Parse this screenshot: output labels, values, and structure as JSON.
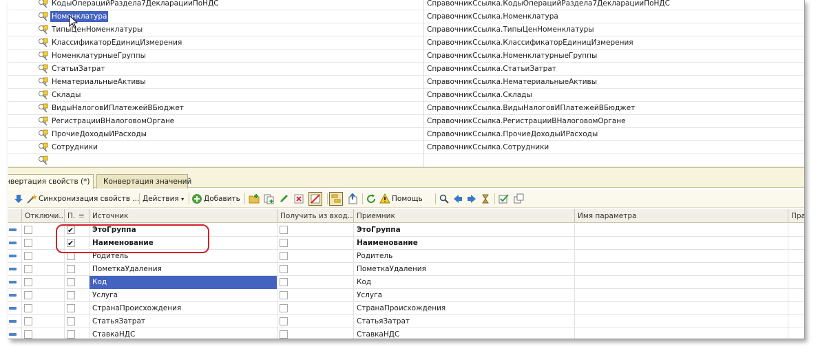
{
  "top_list": {
    "rows": [
      {
        "name": "КодыОперацийРаздела7ДекларацииПоНДС",
        "ref": "СправочникСсылка.КодыОперацийРаздела7ДекларацииПоНДС",
        "selected": false
      },
      {
        "name": "Номенклатура",
        "ref": "СправочникСсылка.Номенклатура",
        "selected": true
      },
      {
        "name": "ТипыЦенНоменклатуры",
        "ref": "СправочникСсылка.ТипыЦенНоменклатуры",
        "selected": false
      },
      {
        "name": "КлассификаторЕдиницИзмерения",
        "ref": "СправочникСсылка.КлассификаторЕдиницИзмерения",
        "selected": false
      },
      {
        "name": "НоменклатурныеГруппы",
        "ref": "СправочникСсылка.НоменклатурныеГруппы",
        "selected": false
      },
      {
        "name": "СтатьиЗатрат",
        "ref": "СправочникСсылка.СтатьиЗатрат",
        "selected": false
      },
      {
        "name": "НематериальныеАктивы",
        "ref": "СправочникСсылка.НематериальныеАктивы",
        "selected": false
      },
      {
        "name": "Склады",
        "ref": "СправочникСсылка.Склады",
        "selected": false
      },
      {
        "name": "ВидыНалоговИПлатежейВБюджет",
        "ref": "СправочникСсылка.ВидыНалоговИПлатежейВБюджет",
        "selected": false
      },
      {
        "name": "РегистрацииВНалоговомОргане",
        "ref": "СправочникСсылка.РегистрацииВНалоговомОргане",
        "selected": false
      },
      {
        "name": "ПрочиеДоходыИРасходы",
        "ref": "СправочникСсылка.ПрочиеДоходыИРасходы",
        "selected": false
      },
      {
        "name": "Сотрудники",
        "ref": "СправочникСсылка.Сотрудники",
        "selected": false
      },
      {
        "name": "",
        "ref": "",
        "selected": false
      }
    ]
  },
  "tabs": [
    {
      "label": "нвертация свойств (*)",
      "active": true
    },
    {
      "label": "Конвертация значений",
      "active": false
    }
  ],
  "toolbar": {
    "sync_label": "Синхронизация свойств ...",
    "actions_label": "Действия",
    "add_label": "Добавить",
    "help_label": "Помощь"
  },
  "grid": {
    "columns": [
      "Отключи...",
      "П.",
      "Источник",
      "Получить из вход...",
      "Приемник",
      "Имя параметра",
      "Пра"
    ],
    "rows": [
      {
        "disabled": false,
        "p": true,
        "source": "ЭтоГруппа",
        "get_from_input": false,
        "target": "ЭтоГруппа",
        "param": "",
        "bold": true,
        "selected": false
      },
      {
        "disabled": false,
        "p": true,
        "source": "Наименование",
        "get_from_input": false,
        "target": "Наименование",
        "param": "",
        "bold": true,
        "selected": false
      },
      {
        "disabled": false,
        "p": false,
        "source": "Родитель",
        "get_from_input": false,
        "target": "Родитель",
        "param": "",
        "bold": false,
        "selected": false
      },
      {
        "disabled": false,
        "p": false,
        "source": "ПометкаУдаления",
        "get_from_input": false,
        "target": "ПометкаУдаления",
        "param": "",
        "bold": false,
        "selected": false
      },
      {
        "disabled": false,
        "p": false,
        "source": "Код",
        "get_from_input": false,
        "target": "Код",
        "param": "",
        "bold": false,
        "selected": true
      },
      {
        "disabled": false,
        "p": false,
        "source": "Услуга",
        "get_from_input": false,
        "target": "Услуга",
        "param": "",
        "bold": false,
        "selected": false
      },
      {
        "disabled": false,
        "p": false,
        "source": "СтранаПроисхождения",
        "get_from_input": false,
        "target": "СтранаПроисхождения",
        "param": "",
        "bold": false,
        "selected": false
      },
      {
        "disabled": false,
        "p": false,
        "source": "СтатьяЗатрат",
        "get_from_input": false,
        "target": "СтатьяЗатрат",
        "param": "",
        "bold": false,
        "selected": false
      },
      {
        "disabled": false,
        "p": false,
        "source": "СтавкаНДС",
        "get_from_input": false,
        "target": "СтавкаНДС",
        "param": "",
        "bold": false,
        "selected": false
      }
    ]
  },
  "colors": {
    "selection": "#4463c0",
    "highlight_outline": "#d0222a",
    "tab_bg": "#f7f3dc"
  }
}
